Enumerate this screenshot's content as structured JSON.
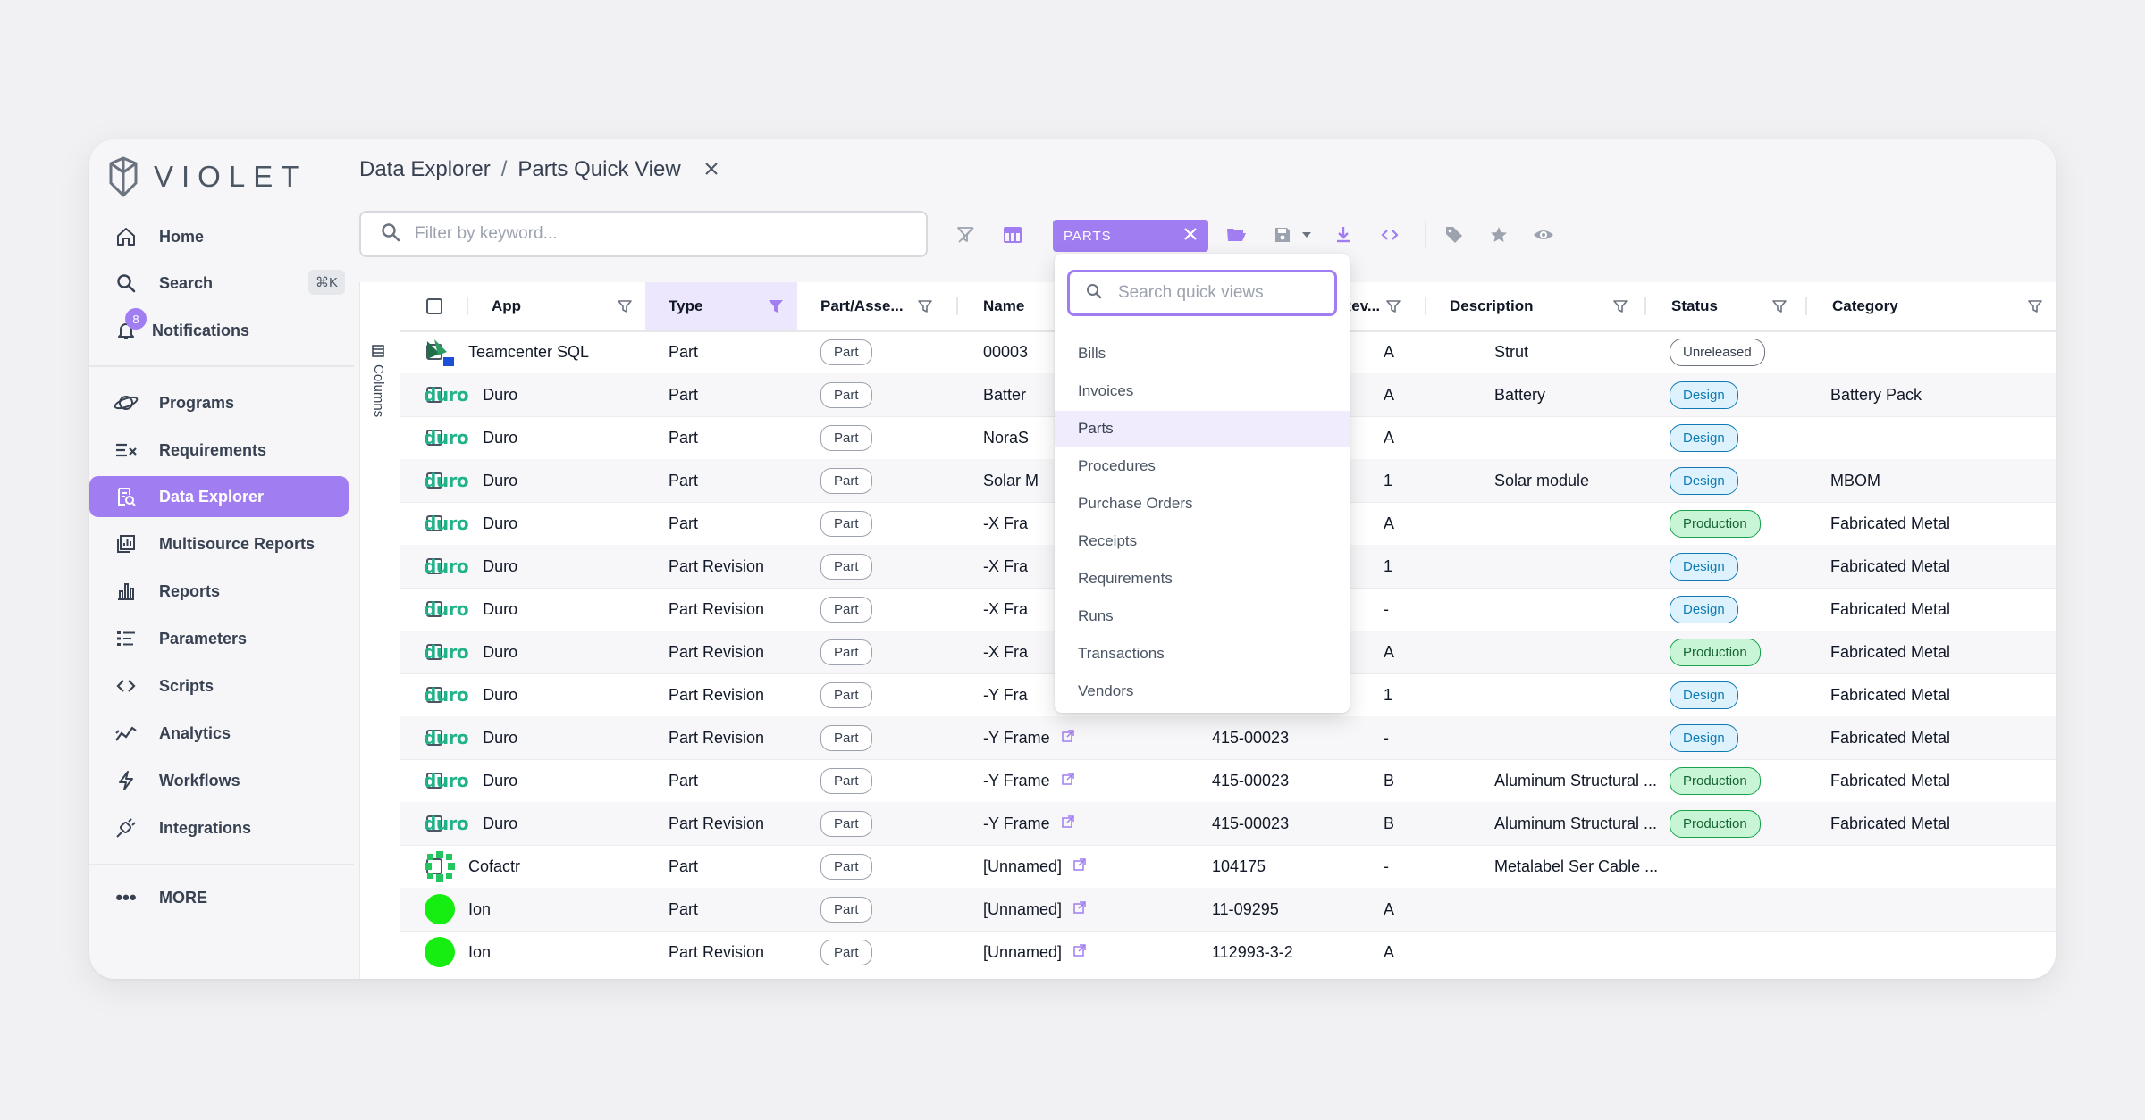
{
  "app": {
    "brand": "VIOLET"
  },
  "sidebar": {
    "items": [
      {
        "label": "Home",
        "icon": "home-icon"
      },
      {
        "label": "Search",
        "icon": "search-icon",
        "shortcut": "⌘K"
      },
      {
        "label": "Notifications",
        "icon": "bell-icon",
        "badge": "8"
      },
      {
        "label": "Programs",
        "icon": "planet-icon"
      },
      {
        "label": "Requirements",
        "icon": "checklist-icon"
      },
      {
        "label": "Data Explorer",
        "icon": "data-explorer-icon"
      },
      {
        "label": "Multisource Reports",
        "icon": "multisource-reports-icon"
      },
      {
        "label": "Reports",
        "icon": "bar-chart-icon"
      },
      {
        "label": "Parameters",
        "icon": "parameters-icon"
      },
      {
        "label": "Scripts",
        "icon": "code-icon"
      },
      {
        "label": "Analytics",
        "icon": "analytics-icon"
      },
      {
        "label": "Workflows",
        "icon": "lightning-icon"
      },
      {
        "label": "Integrations",
        "icon": "plug-icon"
      }
    ],
    "more_label": "MORE"
  },
  "breadcrumb": {
    "root": "Data Explorer",
    "separator": "/",
    "current": "Parts Quick View"
  },
  "search": {
    "placeholder": "Filter by keyword..."
  },
  "quick_view": {
    "selected": "PARTS"
  },
  "columns_panel_label": "Columns",
  "table": {
    "columns": [
      "App",
      "Type",
      "Part/Asse...",
      "Name",
      "Rev...",
      "Description",
      "Status",
      "Category"
    ],
    "rows": [
      {
        "app": "Teamcenter SQL",
        "logo": "teamcenter",
        "type": "Part",
        "pa": "Part",
        "name": "00003",
        "number": "",
        "rev": "A",
        "desc": "Strut",
        "status": "Unreleased",
        "category": ""
      },
      {
        "app": "Duro",
        "logo": "duro",
        "type": "Part",
        "pa": "Part",
        "name": "Batter",
        "number": "",
        "rev": "A",
        "desc": "Battery",
        "status": "Design",
        "category": "Battery Pack"
      },
      {
        "app": "Duro",
        "logo": "duro",
        "type": "Part",
        "pa": "Part",
        "name": "NoraS",
        "number": "",
        "rev": "A",
        "desc": "",
        "status": "Design",
        "category": ""
      },
      {
        "app": "Duro",
        "logo": "duro",
        "type": "Part",
        "pa": "Part",
        "name": "Solar M",
        "number": "",
        "rev": "1",
        "desc": "Solar module",
        "status": "Design",
        "category": "MBOM"
      },
      {
        "app": "Duro",
        "logo": "duro",
        "type": "Part",
        "pa": "Part",
        "name": "-X Fra",
        "number": "",
        "rev": "A",
        "desc": "",
        "status": "Production",
        "category": "Fabricated Metal"
      },
      {
        "app": "Duro",
        "logo": "duro",
        "type": "Part Revision",
        "pa": "Part",
        "name": "-X Fra",
        "number": "",
        "rev": "1",
        "desc": "",
        "status": "Design",
        "category": "Fabricated Metal"
      },
      {
        "app": "Duro",
        "logo": "duro",
        "type": "Part Revision",
        "pa": "Part",
        "name": "-X Fra",
        "number": "",
        "rev": "-",
        "desc": "",
        "status": "Design",
        "category": "Fabricated Metal"
      },
      {
        "app": "Duro",
        "logo": "duro",
        "type": "Part Revision",
        "pa": "Part",
        "name": "-X Fra",
        "number": "",
        "rev": "A",
        "desc": "",
        "status": "Production",
        "category": "Fabricated Metal"
      },
      {
        "app": "Duro",
        "logo": "duro",
        "type": "Part Revision",
        "pa": "Part",
        "name": "-Y Fra",
        "number": "",
        "rev": "1",
        "desc": "",
        "status": "Design",
        "category": "Fabricated Metal"
      },
      {
        "app": "Duro",
        "logo": "duro",
        "type": "Part Revision",
        "pa": "Part",
        "name": "-Y Frame",
        "ext": true,
        "number": "415-00023",
        "rev": "-",
        "desc": "",
        "status": "Design",
        "category": "Fabricated Metal"
      },
      {
        "app": "Duro",
        "logo": "duro",
        "type": "Part",
        "pa": "Part",
        "name": "-Y Frame",
        "ext": true,
        "number": "415-00023",
        "rev": "B",
        "desc": "Aluminum Structural ...",
        "status": "Production",
        "category": "Fabricated Metal"
      },
      {
        "app": "Duro",
        "logo": "duro",
        "type": "Part Revision",
        "pa": "Part",
        "name": "-Y Frame",
        "ext": true,
        "number": "415-00023",
        "rev": "B",
        "desc": "Aluminum Structural ...",
        "status": "Production",
        "category": "Fabricated Metal"
      },
      {
        "app": "Cofactr",
        "logo": "cofactr",
        "type": "Part",
        "pa": "Part",
        "name": "[Unnamed]",
        "ext": true,
        "number": "104175",
        "rev": "-",
        "desc": "Metalabel Ser Cable ...",
        "status": "",
        "category": ""
      },
      {
        "app": "Ion",
        "logo": "ion",
        "type": "Part",
        "pa": "Part",
        "name": "[Unnamed]",
        "ext": true,
        "number": "11-09295",
        "rev": "A",
        "desc": "",
        "status": "",
        "category": ""
      },
      {
        "app": "Ion",
        "logo": "ion",
        "type": "Part Revision",
        "pa": "Part",
        "name": "[Unnamed]",
        "ext": true,
        "number": "112993-3-2",
        "rev": "A",
        "desc": "",
        "status": "",
        "category": ""
      }
    ]
  },
  "dropdown": {
    "placeholder": "Search quick views",
    "items": [
      "Bills",
      "Invoices",
      "Parts",
      "Procedures",
      "Purchase Orders",
      "Receipts",
      "Requirements",
      "Runs",
      "Transactions",
      "Vendors"
    ],
    "selected": "Parts"
  },
  "colors": {
    "accent": "#a17df2",
    "duro": "#22b28a",
    "design": "#0e7bb5",
    "production": "#16a34a"
  }
}
